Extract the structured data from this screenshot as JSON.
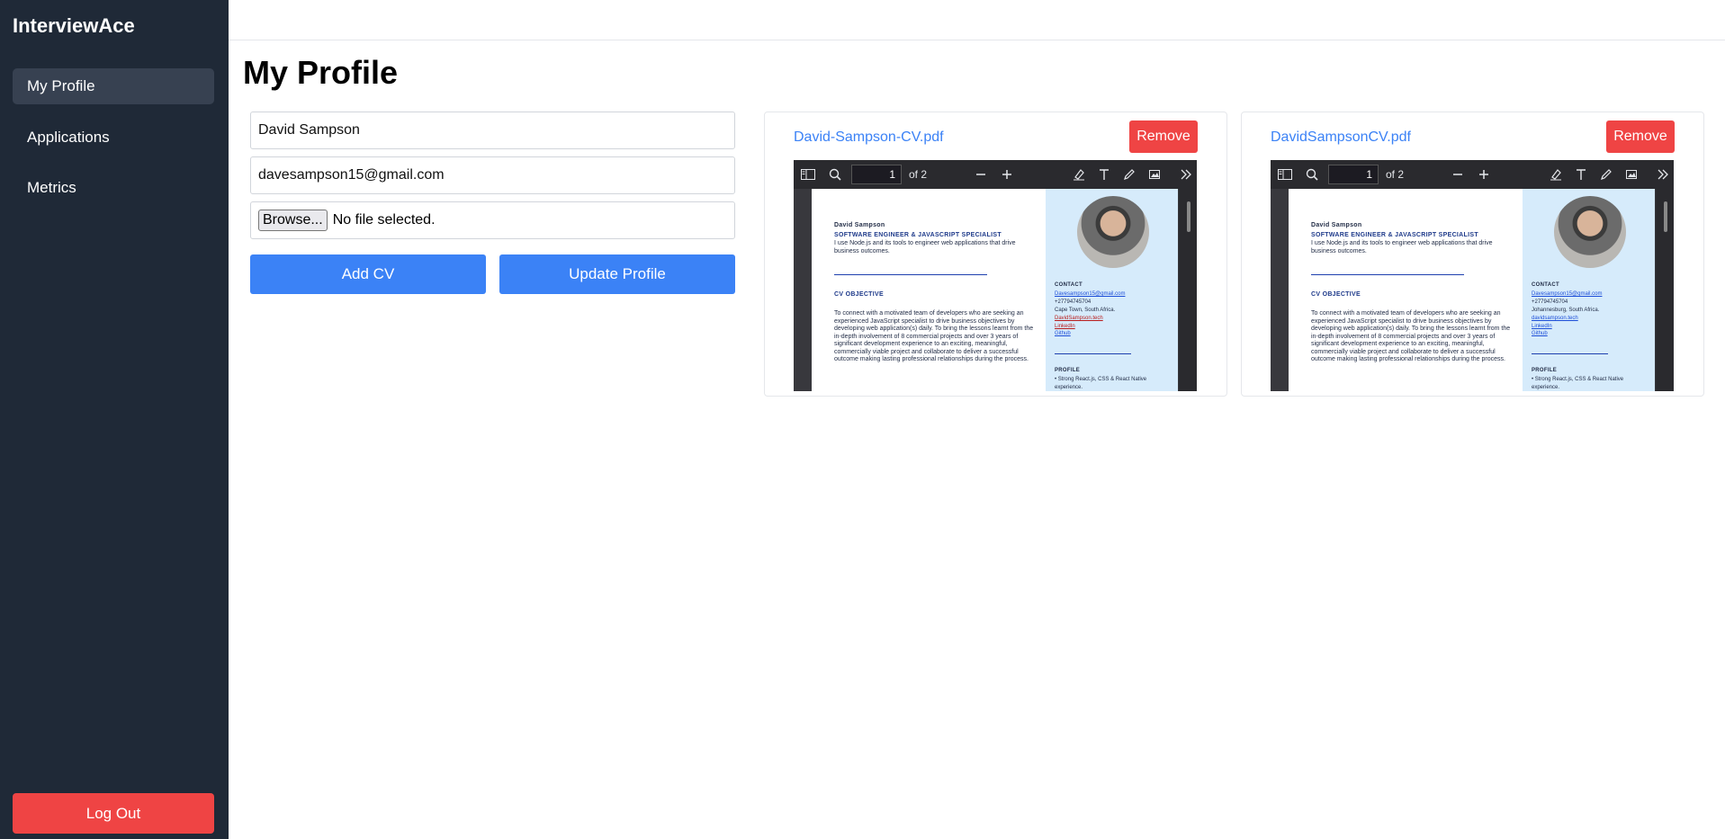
{
  "app": {
    "brand": "InterviewAce"
  },
  "sidebar": {
    "items": [
      {
        "label": "My Profile",
        "active": true
      },
      {
        "label": "Applications",
        "active": false
      },
      {
        "label": "Metrics",
        "active": false
      }
    ],
    "logout_label": "Log Out"
  },
  "page": {
    "title": "My Profile"
  },
  "form": {
    "name_value": "David Sampson",
    "email_value": "davesampson15@gmail.com",
    "browse_label": "Browse...",
    "file_status": "No file selected.",
    "add_cv_label": "Add CV",
    "update_profile_label": "Update Profile"
  },
  "cvs": [
    {
      "filename": "David-Sampson-CV.pdf",
      "remove_label": "Remove",
      "viewer": {
        "page_value": "1",
        "page_total": "of 2"
      },
      "doc": {
        "name": "David Sampson",
        "role": "SOFTWARE ENGINEER & JAVASCRIPT SPECIALIST",
        "tagline": "I use Node.js and its tools to engineer web applications that drive business outcomes.",
        "objective_heading": "CV OBJECTIVE",
        "objective": "To connect with a motivated team of developers who are seeking an experienced JavaScript specialist to drive business objectives by developing web application(s) daily. To bring the lessons learnt from the in-depth involvement of 8 commercial projects and over 3 years of significant development experience to an exciting, meaningful, commercially viable project and collaborate to deliver a successful outcome making lasting professional relationships during the process.",
        "contact_heading": "CONTACT",
        "email": "Davesampson15@gmail.com",
        "phone": "+27794745704",
        "location": "Cape Town, South Africa.",
        "site": "DavidSampson.tech",
        "linkedin": "LinkedIn",
        "github": "Github",
        "profile_heading": "PROFILE",
        "profile_item": "• Strong React.js, CSS & React Native experience."
      }
    },
    {
      "filename": "DavidSampsonCV.pdf",
      "remove_label": "Remove",
      "viewer": {
        "page_value": "1",
        "page_total": "of 2"
      },
      "doc": {
        "name": "David Sampson",
        "role": "SOFTWARE ENGINEER & JAVASCRIPT SPECIALIST",
        "tagline": "I use Node.js and its tools to engineer web applications that drive business outcomes.",
        "objective_heading": "CV OBJECTIVE",
        "objective": "To connect with a motivated team of developers who are seeking an experienced JavaScript specialist to drive business objectives by developing web application(s) daily. To bring the lessons learnt from the in-depth involvement of 8 commercial projects and over 3 years of significant development experience to an exciting, meaningful, commercially viable project and collaborate to deliver a successful outcome making lasting professional relationships during the process.",
        "contact_heading": "CONTACT",
        "email": "Davesampson15@gmail.com",
        "phone": "+27794745704",
        "location": "Johannesburg, South Africa.",
        "site": "davidsampson.tech",
        "linkedin": "LinkedIn",
        "github": "Github",
        "profile_heading": "PROFILE",
        "profile_item": "• Strong React.js, CSS & React Native experience."
      }
    }
  ],
  "colors": {
    "sidebar_bg": "#1f2937",
    "sidebar_active": "#374151",
    "primary": "#3b82f6",
    "danger": "#ef4444"
  },
  "icons": [
    "sidebar-toggle-icon",
    "search-icon",
    "zoom-out-icon",
    "zoom-in-icon",
    "highlight-icon",
    "text-icon",
    "draw-icon",
    "image-icon",
    "more-tools-icon"
  ]
}
